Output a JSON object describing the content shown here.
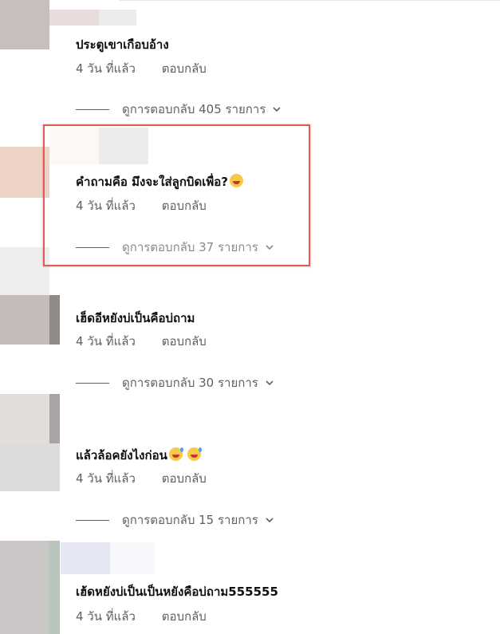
{
  "comments": [
    {
      "text": "ประตูเขาเกือบอ้าง",
      "time": "4 วัน ที่แล้ว",
      "reply_label": "ตอบกลับ",
      "replies_label": "ดูการตอบกลับ 405 รายการ"
    },
    {
      "text": "คำถามคือ มึงจะใส่ลูกบิดเพื่อ?",
      "time": "4 วัน ที่แล้ว",
      "reply_label": "ตอบกลับ",
      "replies_label": "ดูการตอบกลับ 37 รายการ"
    },
    {
      "text": "เฮ็ดอีหยังบ่เป็นคือบ่ถาม",
      "time": "4 วัน ที่แล้ว",
      "reply_label": "ตอบกลับ",
      "replies_label": "ดูการตอบกลับ 30 รายการ"
    },
    {
      "text": "แล้วล้อคยังไงก่อน",
      "time": "4 วัน ที่แล้ว",
      "reply_label": "ตอบกลับ",
      "replies_label": "ดูการตอบกลับ 15 รายการ"
    },
    {
      "text": "เฮ้ดหยังบ่เป็นเป็นหยังคือบ่ถาม555555",
      "time": "4 วัน ที่แล้ว",
      "reply_label": "ตอบกลับ"
    }
  ],
  "icons": {
    "expand": "chevron-down-icon",
    "emoji": "laughing-face-icon",
    "emoji_sweat": "grinning-sweat-icon"
  },
  "colors": {
    "highlight": "#e25b55",
    "secondary_text": "#606060"
  }
}
